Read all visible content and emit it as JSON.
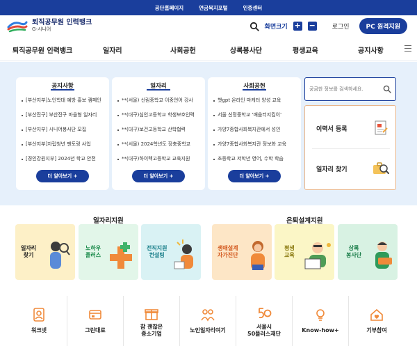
{
  "topbar": {
    "links": [
      "공단홈페이지",
      "연금복지포털",
      "인증센터"
    ]
  },
  "header": {
    "logo_title": "퇴직공무원 인력뱅크",
    "logo_sub": "G-시니어",
    "font_size_label": "화면크기",
    "plus": "+",
    "minus": "−",
    "login": "로그인",
    "pc_remote": "PC 원격지원"
  },
  "nav": {
    "items": [
      "퇴직공무원 인력뱅크",
      "일자리",
      "사회공헌",
      "상록봉사단",
      "평생교육",
      "공지사항"
    ]
  },
  "cards": [
    {
      "title": "공지사항",
      "items": [
        "[부산지부]노인학대 예방 홍보 캠페인",
        "[부산진구] 부산진구 마을형 일자리",
        "[부산지부] 시니어봉사단 모집",
        "[부산지부]자립청년 멘토링 사업",
        "[경인강원지부] 2024년 학교 안전"
      ],
      "more": "더 알아보기 +"
    },
    {
      "title": "일자리",
      "items": [
        "**(서울) 신림중학교 이중언어 강사",
        "**(대구)심인고등학교 학생보호인력",
        "**(대구)보건고등학교 산학협력",
        "**(서울) 2024학년도 장충중학교",
        "**(대구)하이텍고등학교 교육지원"
      ],
      "more": "더 알아보기 +"
    },
    {
      "title": "사회공헌",
      "items": [
        "챗gpt 온라인 마케터 양성 교육",
        "서울 신정중학교 '배움터지킴이'",
        "가양7종합사회복지관에서 성인",
        "가양7종합사회복지관 정보화 교육",
        "초등학교 저학년 영어, 수학 학습"
      ],
      "more": "더 알아보기 +"
    }
  ],
  "search": {
    "placeholder": "궁금한 정보를 검색하세요."
  },
  "side": {
    "resume": "이력서 등록",
    "jobs": "일자리 찾기"
  },
  "sections": {
    "job_support": "일자리지원",
    "retire_support": "은퇴설계지원"
  },
  "tiles": [
    {
      "label1": "일자리",
      "label2": "찾기",
      "bg": "#fdf0c7",
      "fg": "#222222"
    },
    {
      "label1": "노하우",
      "label2": "플러스",
      "bg": "#e2f6e9",
      "fg": "#1a8a4a"
    },
    {
      "label1": "전직지원",
      "label2": "컨설팅",
      "bg": "#d9f2f4",
      "fg": "#1a7f8a"
    },
    {
      "label1": "생애설계",
      "label2": "자가진단",
      "bg": "#fde6c6",
      "fg": "#d2571c"
    },
    {
      "label1": "평생",
      "label2": "교육",
      "bg": "#fbf6c6",
      "fg": "#8a7a10"
    },
    {
      "label1": "상록",
      "label2": "봉사단",
      "bg": "#d8f2e3",
      "fg": "#1b7d4a"
    }
  ],
  "bottom": [
    {
      "label1": "워크넷",
      "label2": ""
    },
    {
      "label1": "그린대로",
      "label2": ""
    },
    {
      "label1": "참 괜찮은",
      "label2": "중소기업"
    },
    {
      "label1": "노인일자리여기",
      "label2": ""
    },
    {
      "label1": "서울시",
      "label2": "50플러스재단"
    },
    {
      "label1": "Know-how+",
      "label2": ""
    },
    {
      "label1": "기부참여",
      "label2": ""
    }
  ],
  "icons": {
    "accent": "#1a3e9c",
    "orange": "#f08a3a"
  }
}
